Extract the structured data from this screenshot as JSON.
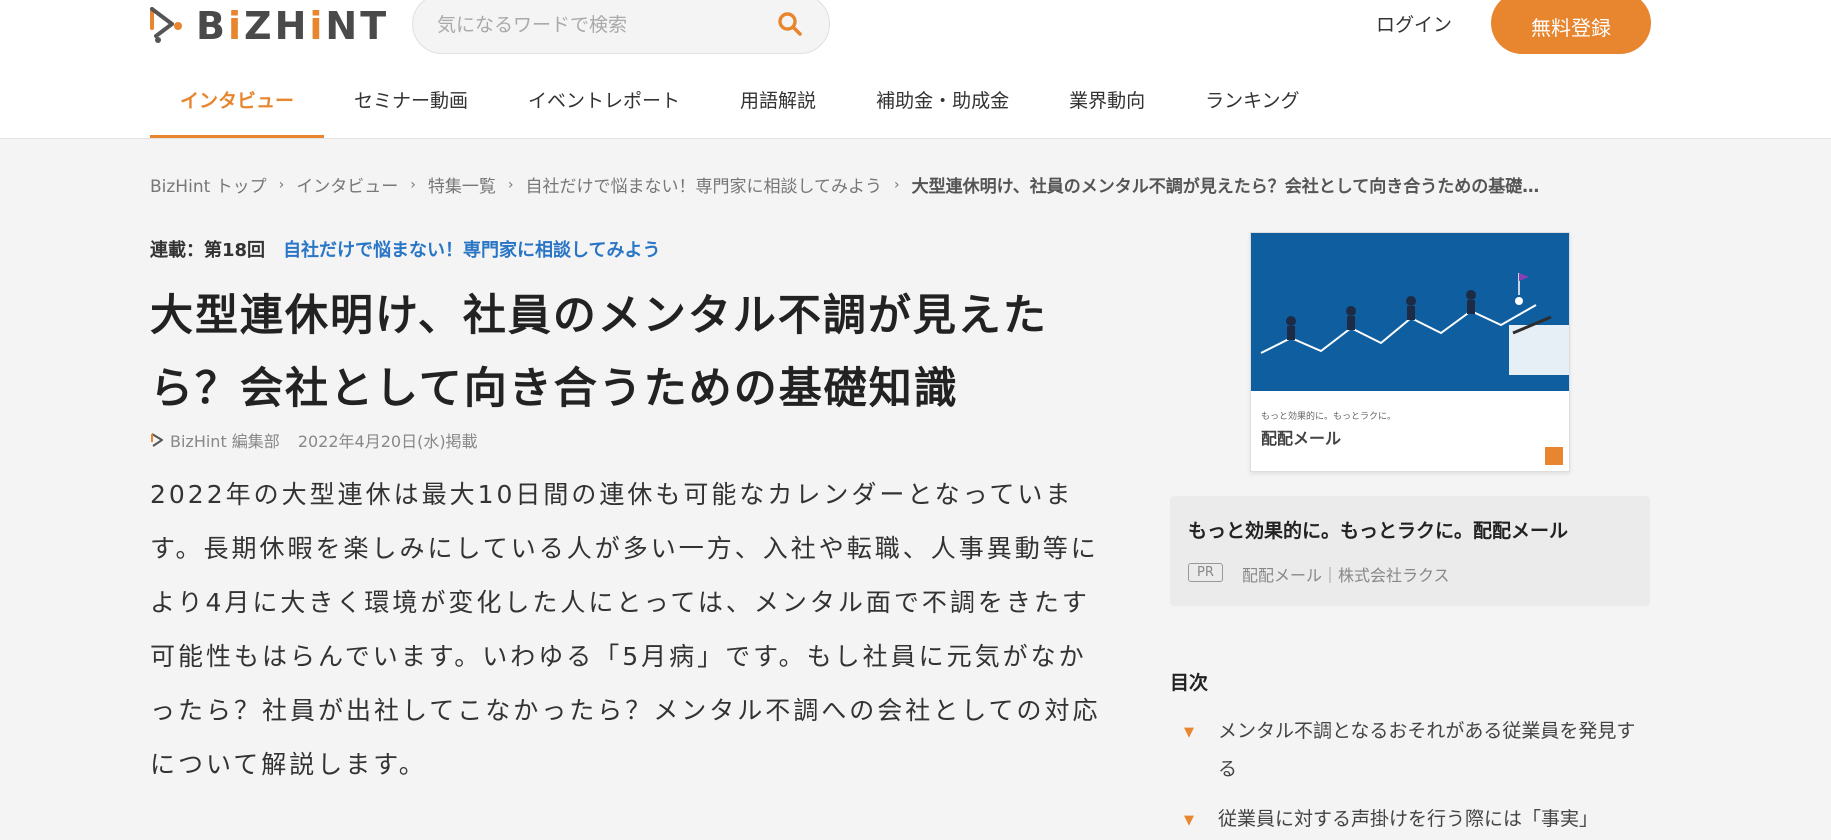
{
  "header": {
    "logo_parts": [
      "B",
      "i",
      "Z",
      "H",
      "i",
      "NT"
    ],
    "logo_text": "BiZHiNT",
    "search_placeholder": "気になるワードで検索",
    "login_label": "ログイン",
    "signup_label": "無料登録"
  },
  "nav": {
    "items": [
      {
        "label": "インタビュー",
        "active": true
      },
      {
        "label": "セミナー動画"
      },
      {
        "label": "イベントレポート"
      },
      {
        "label": "用語解説"
      },
      {
        "label": "補助金・助成金"
      },
      {
        "label": "業界動向"
      },
      {
        "label": "ランキング"
      }
    ]
  },
  "breadcrumb": {
    "items": [
      "BizHint トップ",
      "インタビュー",
      "特集一覧",
      "自社だけで悩まない！専門家に相談してみよう",
      "大型連休明け、社員のメンタル不調が見えたら？会社として向き合うための基礎…"
    ]
  },
  "article": {
    "series_label": "連載：第18回",
    "series_title": "自社だけで悩まない！専門家に相談してみよう",
    "title": "大型連休明け、社員のメンタル不調が見えたら？会社として向き合うための基礎知識",
    "author": "BizHint 編集部",
    "date": "2022年4月20日(水)掲載",
    "lead": "2022年の大型連休は最大10日間の連休も可能なカレンダーとなっています。長期休暇を楽しみにしている人が多い一方、入社や転職、人事異動等により4月に大きく環境が変化した人にとっては、メンタル面で不調をきたす可能性もはらんでいます。いわゆる「5月病」です。もし社員に元気がなかったら？社員が出社してこなかったら？メンタル不調への会社としての対応について解説します。"
  },
  "sidebar": {
    "ad_image_caption": "もっと効果的に。もっとラクに。",
    "ad_image_product": "配配メール",
    "ad_title": "もっと効果的に。もっとラクに。配配メール",
    "ad_badge": "PR",
    "ad_source": "配配メール｜株式会社ラクス",
    "toc_heading": "目次",
    "toc_items": [
      "メンタル不調となるおそれがある従業員を発見する",
      "従業員に対する声掛けを行う際には「事実」"
    ]
  },
  "colors": {
    "accent": "#e8852f",
    "link": "#2a76c6",
    "background": "#f4f4f4"
  },
  "icons": [
    "logo-mark-icon",
    "search-icon",
    "author-icon",
    "chevron-right-icon",
    "triangle-down-icon"
  ]
}
